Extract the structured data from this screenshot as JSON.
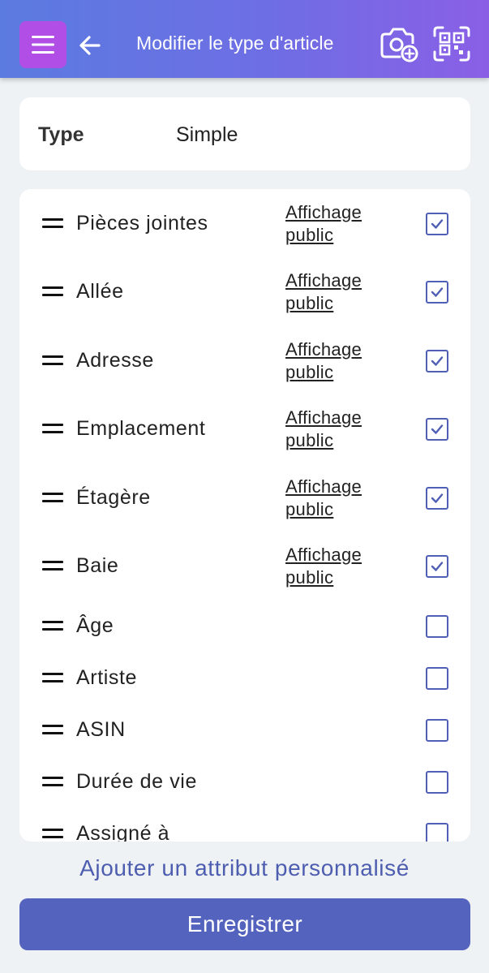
{
  "header": {
    "title": "Modifier le type d'article",
    "menu_icon": "hamburger-icon",
    "back_icon": "arrow-left-icon",
    "camera_icon": "camera-add-icon",
    "scan_icon": "qr-scan-icon"
  },
  "type": {
    "label": "Type",
    "value": "Simple"
  },
  "attributes": [
    {
      "label": "Pièces jointes",
      "public_line1": "Affichage",
      "public_line2": "public",
      "checked": true
    },
    {
      "label": "Allée",
      "public_line1": "Affichage",
      "public_line2": "public",
      "checked": true
    },
    {
      "label": "Adresse",
      "public_line1": "Affichage",
      "public_line2": "public",
      "checked": true
    },
    {
      "label": "Emplacement",
      "public_line1": "Affichage",
      "public_line2": "public",
      "checked": true
    },
    {
      "label": "Étagère",
      "public_line1": "Affichage",
      "public_line2": "public",
      "checked": true
    },
    {
      "label": "Baie",
      "public_line1": "Affichage",
      "public_line2": "public",
      "checked": true
    },
    {
      "label": "Âge",
      "checked": false
    },
    {
      "label": "Artiste",
      "checked": false
    },
    {
      "label": "ASIN",
      "checked": false
    },
    {
      "label": "Durée de vie",
      "checked": false
    },
    {
      "label": "Assigné à",
      "checked": false
    }
  ],
  "add_attribute_label": "Ajouter un attribut personnalisé",
  "save_label": "Enregistrer",
  "colors": {
    "accent": "#5463bd",
    "menu_button": "#b04ee6",
    "link": "#4d5db0"
  }
}
